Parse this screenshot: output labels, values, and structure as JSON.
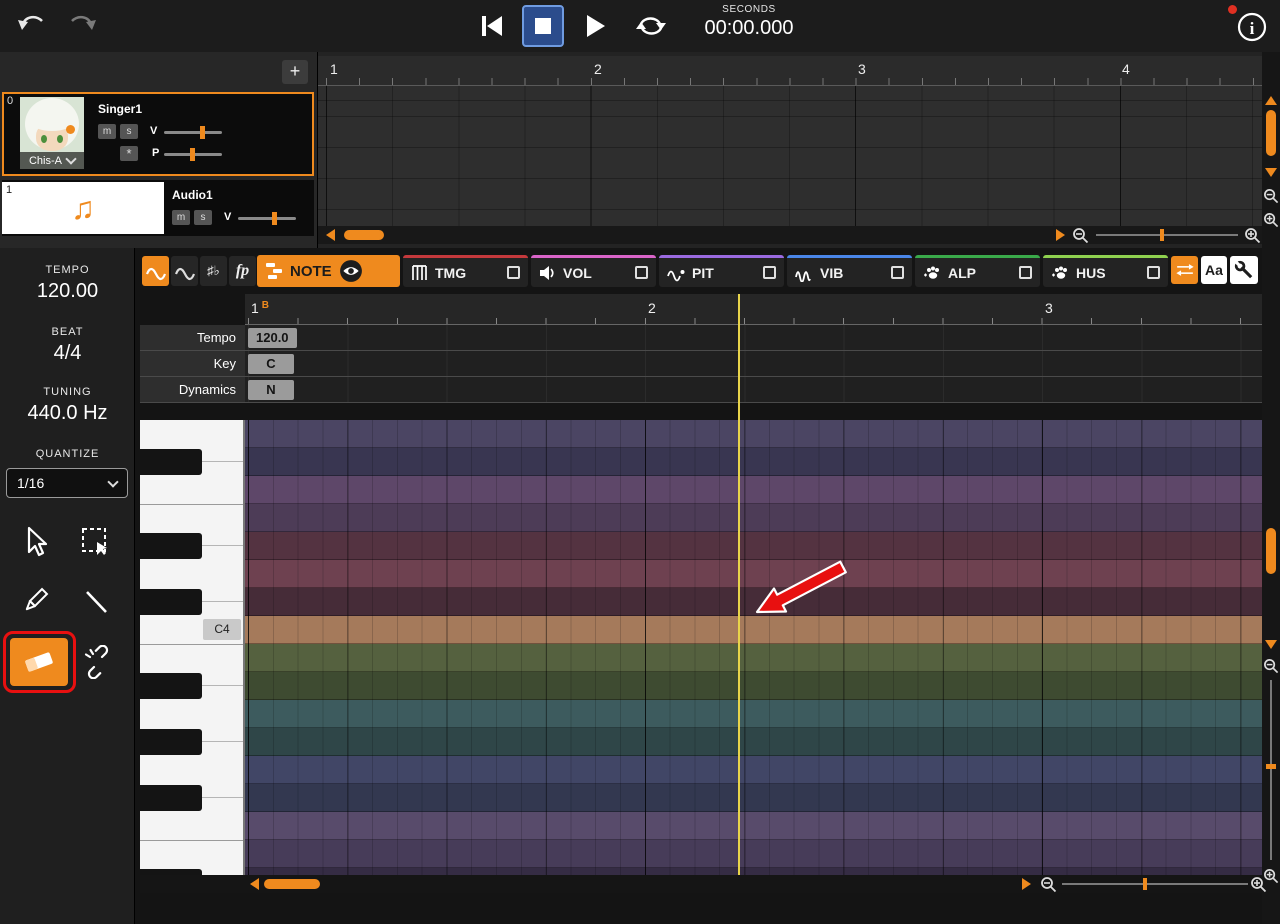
{
  "colors": {
    "accent": "#ef8a1e",
    "playhead": "#e8d44a",
    "annotation": "#e81010",
    "stop_active_bg": "#2b4c8c",
    "stop_active_border": "#6f9be0",
    "tab_note": "#ef8a1e",
    "tab_tmg": "#c4393c",
    "tab_vol": "#d964c8",
    "tab_pit": "#9a6ae0",
    "tab_vib": "#4a86e8",
    "tab_alp": "#3aa94a",
    "tab_hus": "#8fd14f"
  },
  "topbar": {
    "time_unit": "SECONDS",
    "time": "00:00.000",
    "info_glyph": "i"
  },
  "track_panel": {
    "add": "+"
  },
  "tracks": [
    {
      "index": "0",
      "name": "Singer1",
      "voice": "Chis-A",
      "mute": "m",
      "solo": "s",
      "volume": "V",
      "pan": "P",
      "star": "*"
    },
    {
      "index": "1",
      "name": "Audio1",
      "mute": "m",
      "solo": "s",
      "volume": "V",
      "note_icon": "♫"
    }
  ],
  "arrange": {
    "measures": [
      "1",
      "2",
      "3",
      "4"
    ]
  },
  "sidebar": {
    "tempo": {
      "label": "TEMPO",
      "value": "120.00"
    },
    "beat": {
      "label": "BEAT",
      "value": "4/4"
    },
    "tuning": {
      "label": "TUNING",
      "value": "440.0 Hz"
    },
    "quantize": {
      "label": "QUANTIZE",
      "value": "1/16"
    }
  },
  "toolbar": {
    "accidentals": "♯♭",
    "dynamics": "fp",
    "aa": "Aa",
    "tabs": [
      {
        "label": "NOTE"
      },
      {
        "label": "TMG"
      },
      {
        "label": "VOL"
      },
      {
        "label": "PIT"
      },
      {
        "label": "VIB"
      },
      {
        "label": "ALP"
      },
      {
        "label": "HUS"
      }
    ]
  },
  "params": {
    "ruler": {
      "m1": "1",
      "beat": "B",
      "m2": "2",
      "m3": "3"
    },
    "rows": [
      {
        "label": "Tempo",
        "value": "120.0"
      },
      {
        "label": "Key",
        "value": "C"
      },
      {
        "label": "Dynamics",
        "value": "N"
      }
    ]
  },
  "piano": {
    "c4": "C4",
    "keys": [
      "w",
      "b",
      "w",
      "w",
      "b",
      "w",
      "b",
      "w",
      "w",
      "b",
      "w",
      "b",
      "w",
      "b",
      "w",
      "w",
      "b"
    ],
    "row_colors": [
      "#4b4563",
      "#393651",
      "#5e4769",
      "#4d3c57",
      "#543341",
      "#6e4150",
      "#462c38",
      "#a57a5b",
      "#55613f",
      "#3e4b31",
      "#3d5b5e",
      "#2f4648",
      "#414666",
      "#333850",
      "#584b6b",
      "#473c59",
      "#352c44"
    ]
  }
}
